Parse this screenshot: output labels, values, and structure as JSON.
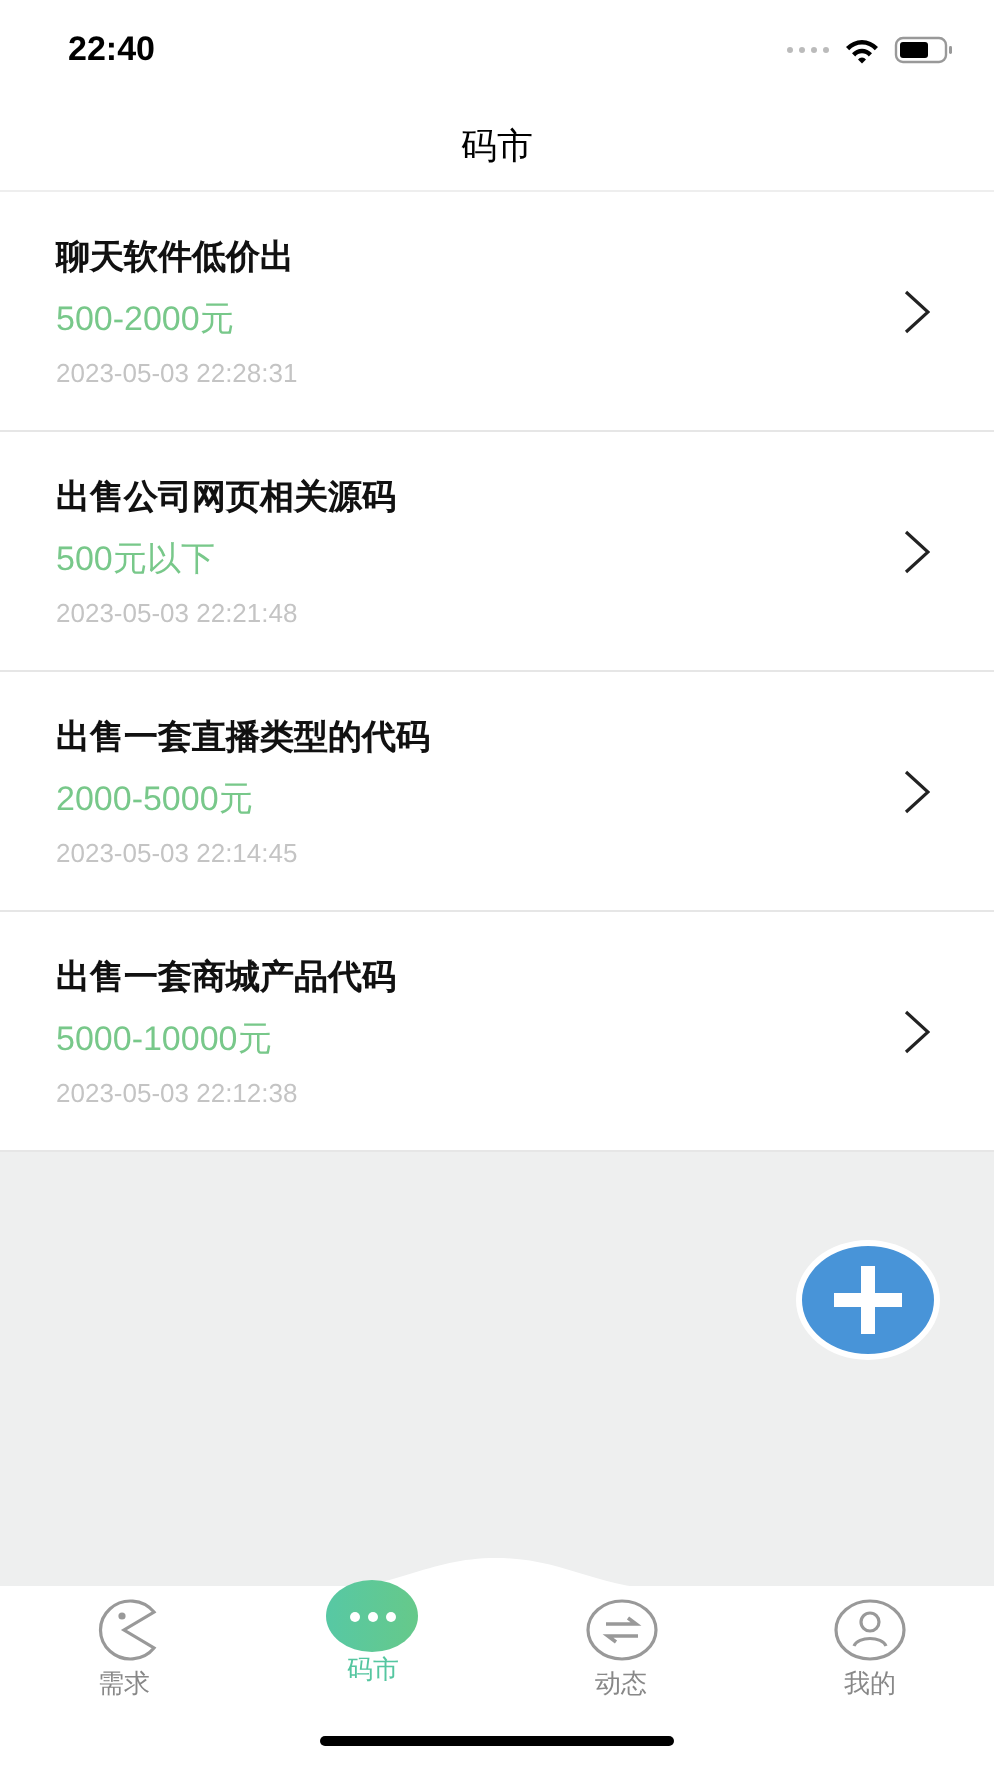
{
  "status_bar": {
    "time": "22:40"
  },
  "header": {
    "title": "码市"
  },
  "listings": [
    {
      "title": "聊天软件低价出",
      "price": "500-2000元",
      "time": "2023-05-03 22:28:31"
    },
    {
      "title": "出售公司网页相关源码",
      "price": "500元以下",
      "time": "2023-05-03 22:21:48"
    },
    {
      "title": "出售一套直播类型的代码",
      "price": "2000-5000元",
      "time": "2023-05-03 22:14:45"
    },
    {
      "title": "出售一套商城产品代码",
      "price": "5000-10000元",
      "time": "2023-05-03 22:12:38"
    }
  ],
  "tabs": [
    {
      "label": "需求",
      "kind": "demand",
      "selected": false
    },
    {
      "label": "码市",
      "kind": "market",
      "selected": true
    },
    {
      "label": "动态",
      "kind": "feed",
      "selected": false
    },
    {
      "label": "我的",
      "kind": "profile",
      "selected": false
    }
  ]
}
